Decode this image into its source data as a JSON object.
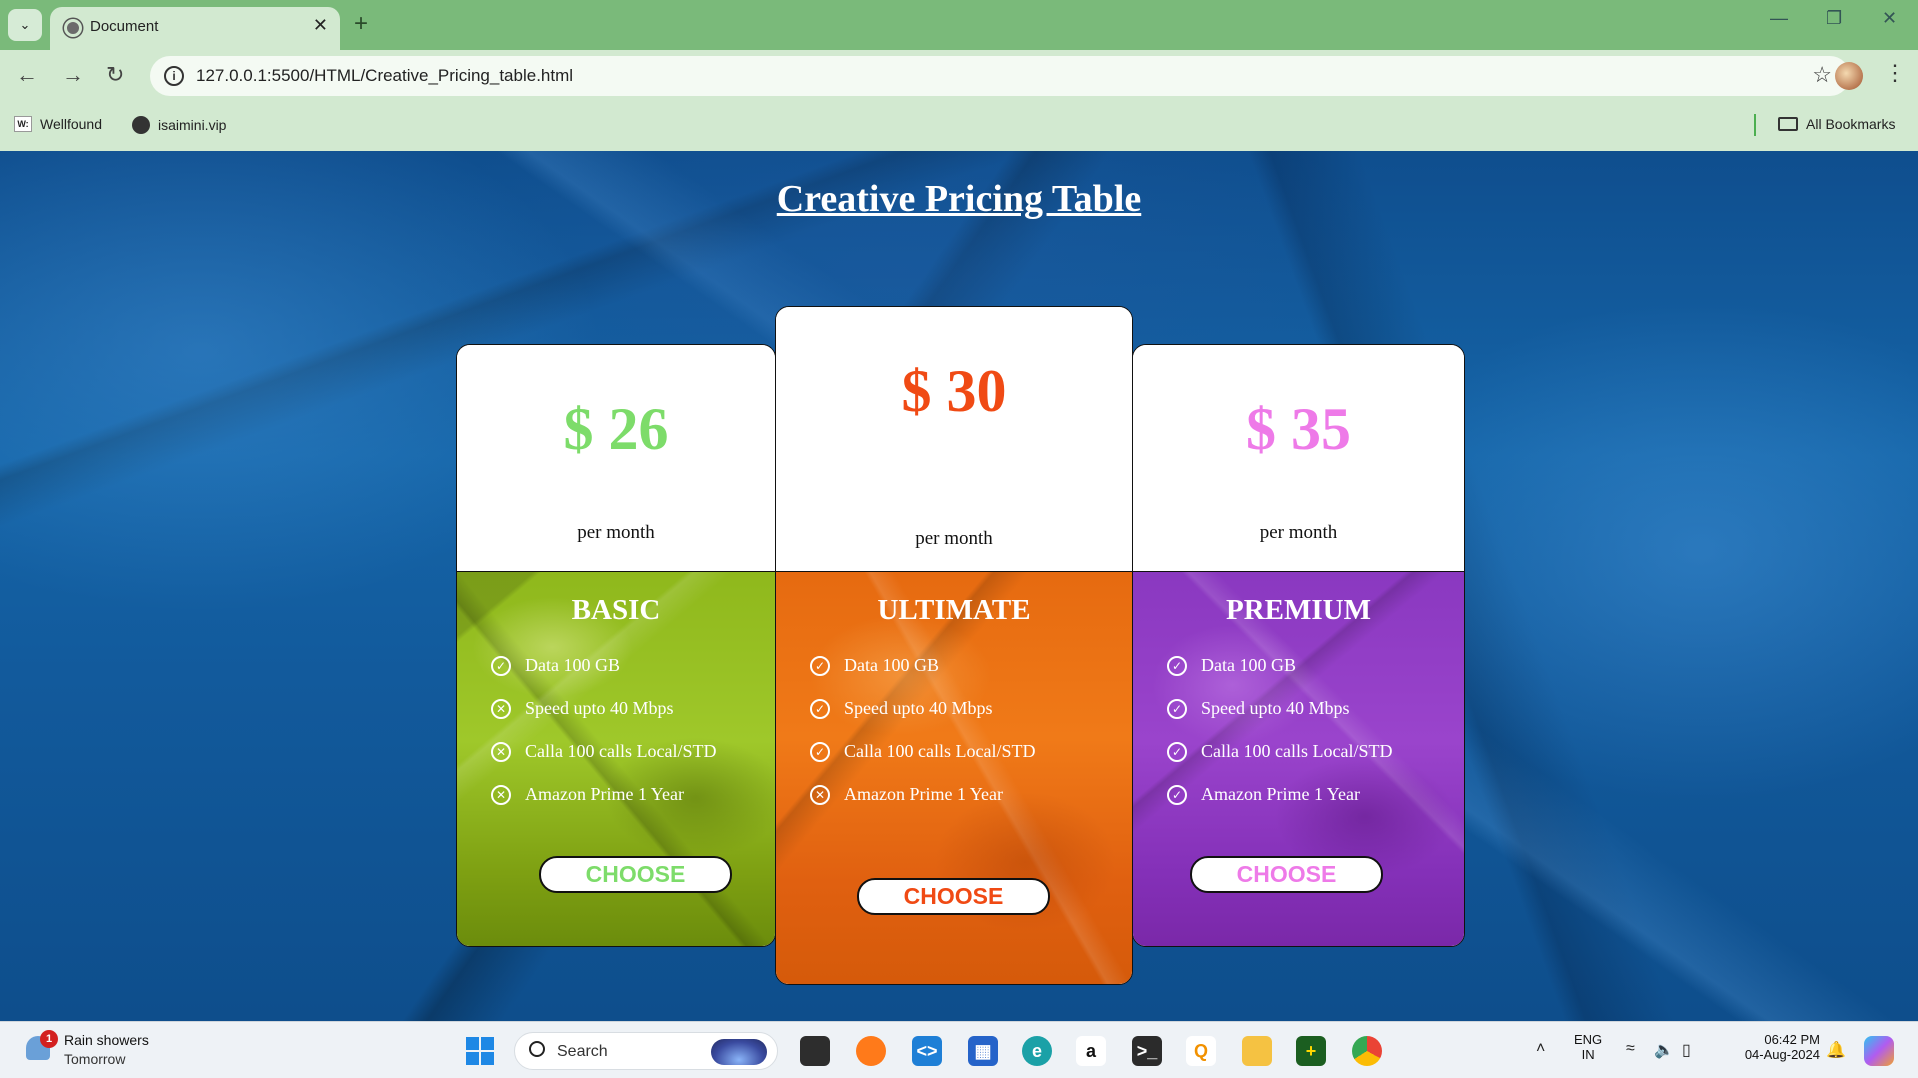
{
  "browser": {
    "tab_title": "Document",
    "url": "127.0.0.1:5500/HTML/Creative_Pricing_table.html",
    "bookmarks": [
      {
        "label": "Wellfound",
        "icon": "wellfound-icon"
      },
      {
        "label": "isaimini.vip",
        "icon": "globe-icon"
      }
    ],
    "all_bookmarks": "All Bookmarks"
  },
  "page": {
    "title": "Creative Pricing Table",
    "plans": [
      {
        "name": "BASIC",
        "price": "$ 26",
        "period": "per month",
        "price_color": "#7ddc6a",
        "features": [
          {
            "text": "Data 100 GB",
            "included": true
          },
          {
            "text": "Speed upto 40 Mbps",
            "included": false
          },
          {
            "text": "Calla 100 calls Local/STD",
            "included": false
          },
          {
            "text": "Amazon Prime 1 Year",
            "included": false
          }
        ],
        "button": "CHOOSE",
        "button_color": "#7ddc6a"
      },
      {
        "name": "ULTIMATE",
        "price": "$ 30",
        "period": "per month",
        "price_color": "#f04a14",
        "features": [
          {
            "text": "Data 100 GB",
            "included": true
          },
          {
            "text": "Speed upto 40 Mbps",
            "included": true
          },
          {
            "text": "Calla 100 calls Local/STD",
            "included": true
          },
          {
            "text": "Amazon Prime 1 Year",
            "included": false
          }
        ],
        "button": "CHOOSE",
        "button_color": "#f04a14"
      },
      {
        "name": "PREMIUM",
        "price": "$ 35",
        "period": "per month",
        "price_color": "#ee7ae8",
        "features": [
          {
            "text": "Data 100 GB",
            "included": true
          },
          {
            "text": "Speed upto 40 Mbps",
            "included": true
          },
          {
            "text": "Calla 100 calls Local/STD",
            "included": true
          },
          {
            "text": "Amazon Prime 1 Year",
            "included": true
          }
        ],
        "button": "CHOOSE",
        "button_color": "#ee7ae8"
      }
    ]
  },
  "taskbar": {
    "weather_title": "Rain showers",
    "weather_sub": "Tomorrow",
    "weather_badge": "1",
    "search_label": "Search",
    "lang_1": "ENG",
    "lang_2": "IN",
    "time": "06:42 PM",
    "date": "04-Aug-2024"
  }
}
